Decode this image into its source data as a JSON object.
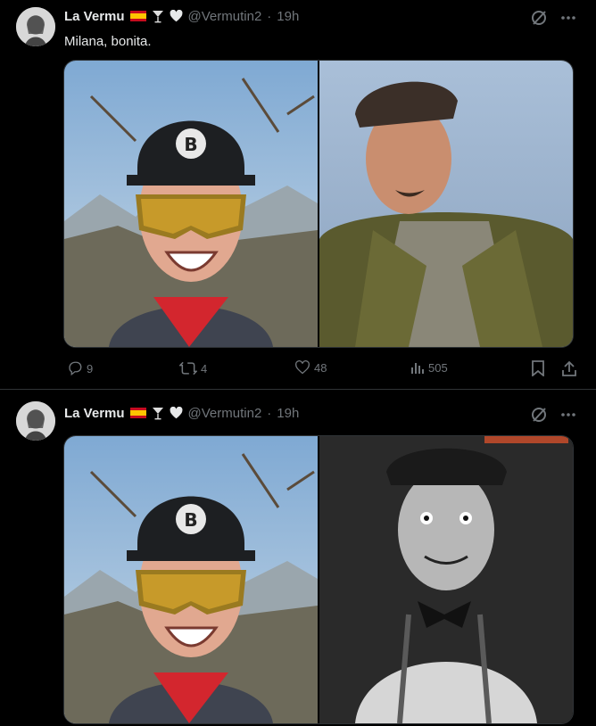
{
  "tweets": [
    {
      "name": "La Vermu",
      "handle": "@Vermutin2",
      "dot": "·",
      "time": "19h",
      "text": "Milana, bonita.",
      "stats": {
        "replies": "9",
        "retweets": "4",
        "likes": "48",
        "views": "505"
      }
    },
    {
      "name": "La Vermu",
      "handle": "@Vermutin2",
      "dot": "·",
      "time": "19h"
    }
  ],
  "icons": [
    "spain-flag-icon",
    "cocktail-icon",
    "heart-icon",
    "grok-icon",
    "more-icon",
    "reply-icon",
    "retweet-icon",
    "like-icon",
    "views-icon",
    "bookmark-icon",
    "share-icon"
  ],
  "colors": {
    "background": "#000000",
    "text": "#e7e9ea",
    "muted": "#71767b",
    "border": "#2f3336"
  }
}
